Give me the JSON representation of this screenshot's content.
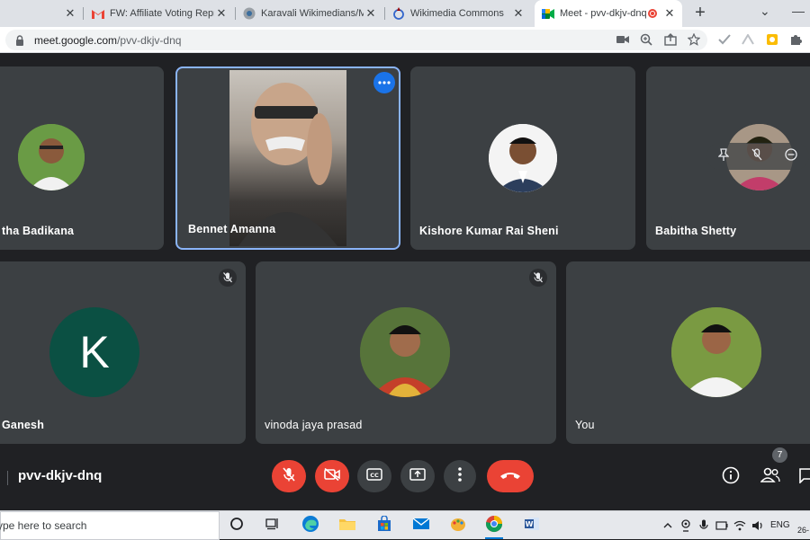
{
  "browser": {
    "tabs": [
      {
        "title": "FW: Affiliate Voting Repre",
        "icon": "gmail-icon"
      },
      {
        "title": "Karavali Wikimedians/Me",
        "icon": "wiki-globe-icon"
      },
      {
        "title": "Wikimedia Commons",
        "icon": "commons-icon"
      },
      {
        "title": "Meet - pvv-dkjv-dnq",
        "icon": "meet-icon"
      }
    ],
    "url_host": "meet.google.com",
    "url_path": "/pvv-dkjv-dnq"
  },
  "meeting": {
    "code": "pvv-dkjv-dnq",
    "participant_count": "7",
    "participants_row1": [
      {
        "name": "tha Badikana"
      },
      {
        "name": "Bennet Amanna"
      },
      {
        "name": "Kishore Kumar Rai Sheni"
      },
      {
        "name": "Babitha Shetty"
      }
    ],
    "participants_row2": [
      {
        "name": "Ganesh",
        "initial": "K"
      },
      {
        "name": "vinoda jaya prasad"
      },
      {
        "name": "You"
      }
    ]
  },
  "taskbar": {
    "search_placeholder": "ype here to search",
    "language": "ENG",
    "clock_partial": "26-"
  },
  "colors": {
    "stage_bg": "#202124",
    "tile_bg": "#3c4043",
    "danger": "#ea4335",
    "accent": "#1a73e8",
    "speaking_outline": "#8ab4f8",
    "letter_avatar": "#0b5043"
  }
}
